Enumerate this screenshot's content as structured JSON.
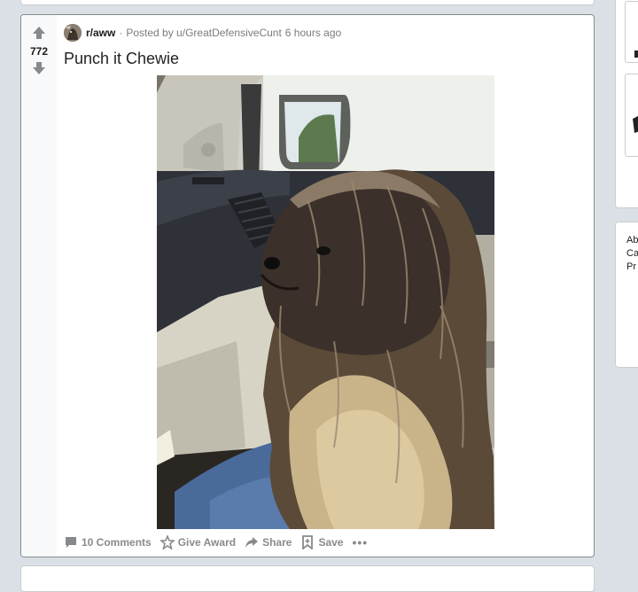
{
  "post": {
    "subreddit": "r/aww",
    "separator": "·",
    "posted_by": "Posted by u/GreatDefensiveCunt",
    "time": "6 hours ago",
    "title": "Punch it Chewie",
    "score": "772",
    "image_alt": "Dog that looks like Chewbacca sitting in a car"
  },
  "actions": {
    "comments": "10 Comments",
    "award": "Give Award",
    "share": "Share",
    "save": "Save",
    "more": "•••"
  },
  "sidebar": {
    "links": [
      "Ab",
      "Ca",
      "Pr"
    ]
  },
  "colors": {
    "page_bg": "#dae0e6",
    "meta_gray": "#787c7e",
    "action_gray": "#878a8c"
  }
}
